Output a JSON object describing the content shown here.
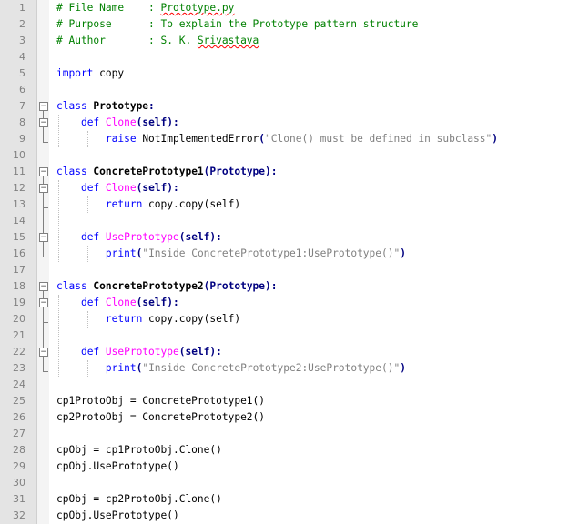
{
  "editor": {
    "line_numbers": [
      "1",
      "2",
      "3",
      "4",
      "5",
      "6",
      "7",
      "8",
      "9",
      "10",
      "11",
      "12",
      "13",
      "14",
      "15",
      "16",
      "17",
      "18",
      "19",
      "20",
      "21",
      "22",
      "23",
      "24",
      "25",
      "26",
      "27",
      "28",
      "29",
      "30",
      "31",
      "32"
    ],
    "code": {
      "l1": {
        "prefix": "# File Name    : ",
        "file": "Prototype.py"
      },
      "l2": "# Purpose      : To explain the Prototype pattern structure",
      "l3": {
        "prefix": "# Author       : S. K. ",
        "name": "Srivastava"
      },
      "l5": {
        "kw": "import",
        "rest": " copy"
      },
      "l7": {
        "kw": "class",
        "name": " Prototype",
        "colon": ":"
      },
      "l8": {
        "kw": "def",
        "fn": " Clone",
        "params": "(self)",
        "colon": ":"
      },
      "l9": {
        "kw": "raise",
        "exc": " NotImplementedError",
        "p1": "(",
        "str": "\"Clone() must be defined in subclass\"",
        "p2": ")"
      },
      "l11": {
        "kw": "class",
        "name": " ConcretePrototype1",
        "base": "(Prototype)",
        "colon": ":"
      },
      "l12": {
        "kw": "def",
        "fn": " Clone",
        "params": "(self)",
        "colon": ":"
      },
      "l13": {
        "kw": "return",
        "rest": " copy.copy(self)"
      },
      "l15": {
        "kw": "def",
        "fn": " UsePrototype",
        "params": "(self)",
        "colon": ":"
      },
      "l16": {
        "kw": "print",
        "p1": "(",
        "str": "\"Inside ConcretePrototype1:UsePrototype()\"",
        "p2": ")"
      },
      "l18": {
        "kw": "class",
        "name": " ConcretePrototype2",
        "base": "(Prototype)",
        "colon": ":"
      },
      "l19": {
        "kw": "def",
        "fn": " Clone",
        "params": "(self)",
        "colon": ":"
      },
      "l20": {
        "kw": "return",
        "rest": " copy.copy(self)"
      },
      "l22": {
        "kw": "def",
        "fn": " UsePrototype",
        "params": "(self)",
        "colon": ":"
      },
      "l23": {
        "kw": "print",
        "p1": "(",
        "str": "\"Inside ConcretePrototype2:UsePrototype()\"",
        "p2": ")"
      },
      "l25": "cp1ProtoObj = ConcretePrototype1()",
      "l26": "cp2ProtoObj = ConcretePrototype2()",
      "l28": "cpObj = cp1ProtoObj.Clone()",
      "l29": "cpObj.UsePrototype()",
      "l31": "cpObj = cp2ProtoObj.Clone()",
      "l32": "cpObj.UsePrototype()"
    },
    "colors": {
      "keyword": "#0000ff",
      "function": "#ff00ff",
      "string": "#808080",
      "comment": "#008000",
      "gutter_bg": "#e4e4e4"
    }
  }
}
